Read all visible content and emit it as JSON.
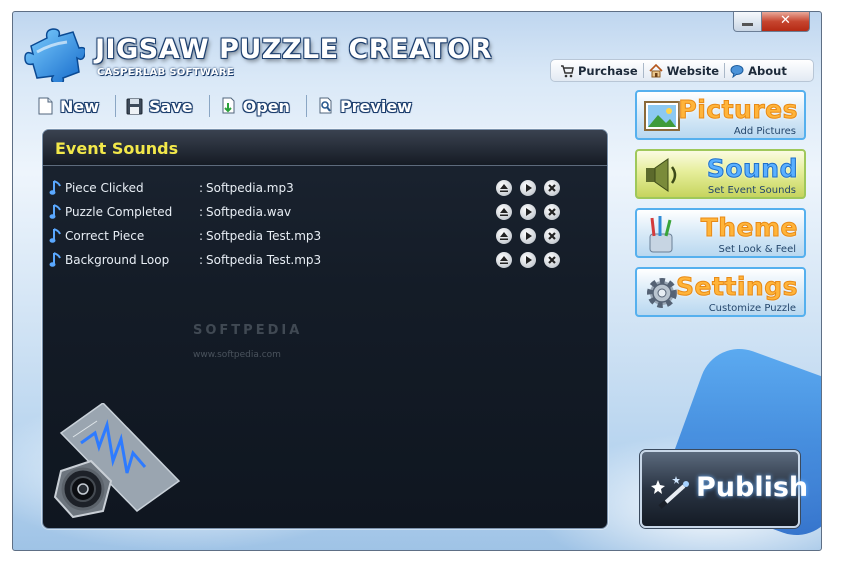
{
  "window": {
    "close_glyph": "✕"
  },
  "header": {
    "title": "JIGSAW PUZZLE CREATOR",
    "subtitle": "CASPERLAB SOFTWARE",
    "links": [
      {
        "label": "Purchase",
        "icon": "cart-icon"
      },
      {
        "label": "Website",
        "icon": "home-icon"
      },
      {
        "label": "About",
        "icon": "chat-icon"
      }
    ]
  },
  "toolbar": {
    "new_label": "New",
    "save_label": "Save",
    "open_label": "Open",
    "preview_label": "Preview"
  },
  "panel": {
    "title": "Event Sounds",
    "watermark": "SOFTPEDIA",
    "watermark_url": "www.softpedia.com",
    "rows": [
      {
        "name": "Piece Clicked",
        "file": "Softpedia.mp3"
      },
      {
        "name": "Puzzle Completed",
        "file": "Softpedia.wav"
      },
      {
        "name": "Correct Piece",
        "file": "Softpedia Test.mp3"
      },
      {
        "name": "Background Loop",
        "file": "Softpedia Test.mp3"
      }
    ],
    "colon": ":"
  },
  "side": {
    "pictures": {
      "label": "Pictures",
      "sub": "Add Pictures"
    },
    "sound": {
      "label": "Sound",
      "sub": "Set Event Sounds"
    },
    "theme": {
      "label": "Theme",
      "sub": "Set Look & Feel"
    },
    "settings": {
      "label": "Settings",
      "sub": "Customize Puzzle"
    }
  },
  "publish": {
    "label": "Publish"
  },
  "colors": {
    "panel_title": "#f2e84a",
    "accent_orange": "#e88a16",
    "accent_blue": "#1e6fc8"
  }
}
